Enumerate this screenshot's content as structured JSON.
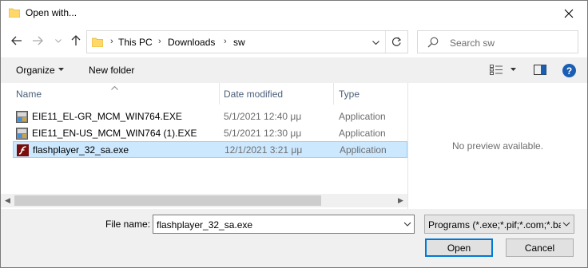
{
  "window": {
    "title": "Open with..."
  },
  "address": {
    "segments": [
      "This PC",
      "Downloads",
      "sw"
    ]
  },
  "search": {
    "placeholder": "Search sw"
  },
  "commands": {
    "organize": "Organize",
    "new_folder": "New folder"
  },
  "columns": {
    "name": "Name",
    "date": "Date modified",
    "type": "Type"
  },
  "files": [
    {
      "name": "EIE11_EL-GR_MCM_WIN764.EXE",
      "date": "5/1/2021 12:40 μμ",
      "type": "Application",
      "icon": "installer-icon",
      "selected": false
    },
    {
      "name": "EIE11_EN-US_MCM_WIN764 (1).EXE",
      "date": "5/1/2021 12:30 μμ",
      "type": "Application",
      "icon": "installer-icon",
      "selected": false
    },
    {
      "name": "flashplayer_32_sa.exe",
      "date": "12/1/2021 3:21 μμ",
      "type": "Application",
      "icon": "flash-icon",
      "selected": true
    }
  ],
  "preview": {
    "text": "No preview available."
  },
  "bottom": {
    "file_name_label": "File name:",
    "file_name_value": "flashplayer_32_sa.exe",
    "filter": "Programs (*.exe;*.pif;*.com;*.bat;*.cmd)",
    "open": "Open",
    "cancel": "Cancel"
  },
  "colors": {
    "selection": "#cce8ff",
    "selection_border": "#99d1ff",
    "accent": "#0078d7",
    "folder": "#ffd867"
  }
}
